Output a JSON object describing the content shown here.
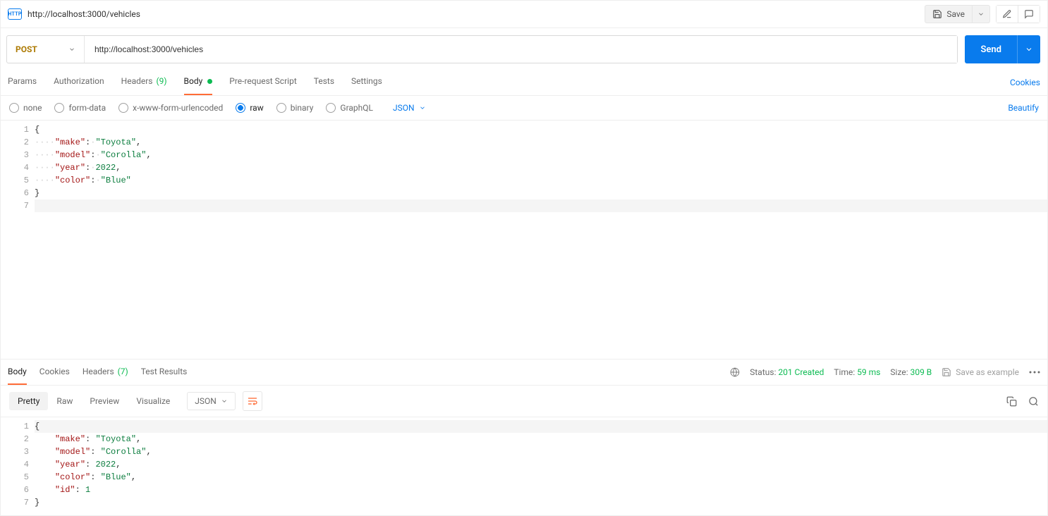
{
  "title": "http://localhost:3000/vehicles",
  "save_label": "Save",
  "method": "POST",
  "url": "http://localhost:3000/vehicles",
  "send_label": "Send",
  "req_tabs": {
    "params": "Params",
    "auth": "Authorization",
    "headers_label": "Headers",
    "headers_count": "(9)",
    "body": "Body",
    "prerequest": "Pre-request Script",
    "tests": "Tests",
    "settings": "Settings"
  },
  "cookies_link": "Cookies",
  "body_types": {
    "none": "none",
    "formdata": "form-data",
    "xwww": "x-www-form-urlencoded",
    "raw": "raw",
    "binary": "binary",
    "graphql": "GraphQL"
  },
  "json_select": "JSON",
  "beautify": "Beautify",
  "req_body_lines": [
    {
      "raw": "{"
    },
    {
      "lead": "····",
      "key": "\"make\"",
      "colon": ":·",
      "val": "\"Toyota\"",
      "tail": ","
    },
    {
      "lead": "····",
      "key": "\"model\"",
      "colon": ":·",
      "val": "\"Corolla\"",
      "tail": ","
    },
    {
      "lead": "····",
      "key": "\"year\"",
      "colon": ":·",
      "val": "2022",
      "tail": ",",
      "num": true
    },
    {
      "lead": "····",
      "key": "\"color\"",
      "colon": ":·",
      "val": "\"Blue\"",
      "tail": ""
    },
    {
      "raw": "}"
    },
    {
      "raw": ""
    }
  ],
  "resp_tabs": {
    "body": "Body",
    "cookies": "Cookies",
    "headers_label": "Headers",
    "headers_count": "(7)",
    "tests": "Test Results"
  },
  "resp_meta": {
    "status_label": "Status:",
    "status_value": "201 Created",
    "time_label": "Time:",
    "time_value": "59 ms",
    "size_label": "Size:",
    "size_value": "309 B",
    "save_example": "Save as example"
  },
  "resp_views": {
    "pretty": "Pretty",
    "raw": "Raw",
    "preview": "Preview",
    "visualize": "Visualize",
    "json": "JSON"
  },
  "resp_body_lines": [
    {
      "raw": "{",
      "hl": true
    },
    {
      "lead": "    ",
      "key": "\"make\"",
      "colon": ": ",
      "val": "\"Toyota\"",
      "tail": ","
    },
    {
      "lead": "    ",
      "key": "\"model\"",
      "colon": ": ",
      "val": "\"Corolla\"",
      "tail": ","
    },
    {
      "lead": "    ",
      "key": "\"year\"",
      "colon": ": ",
      "val": "2022",
      "tail": ",",
      "num": true
    },
    {
      "lead": "    ",
      "key": "\"color\"",
      "colon": ": ",
      "val": "\"Blue\"",
      "tail": ","
    },
    {
      "lead": "    ",
      "key": "\"id\"",
      "colon": ": ",
      "val": "1",
      "tail": "",
      "num": true
    },
    {
      "raw": "}"
    }
  ]
}
